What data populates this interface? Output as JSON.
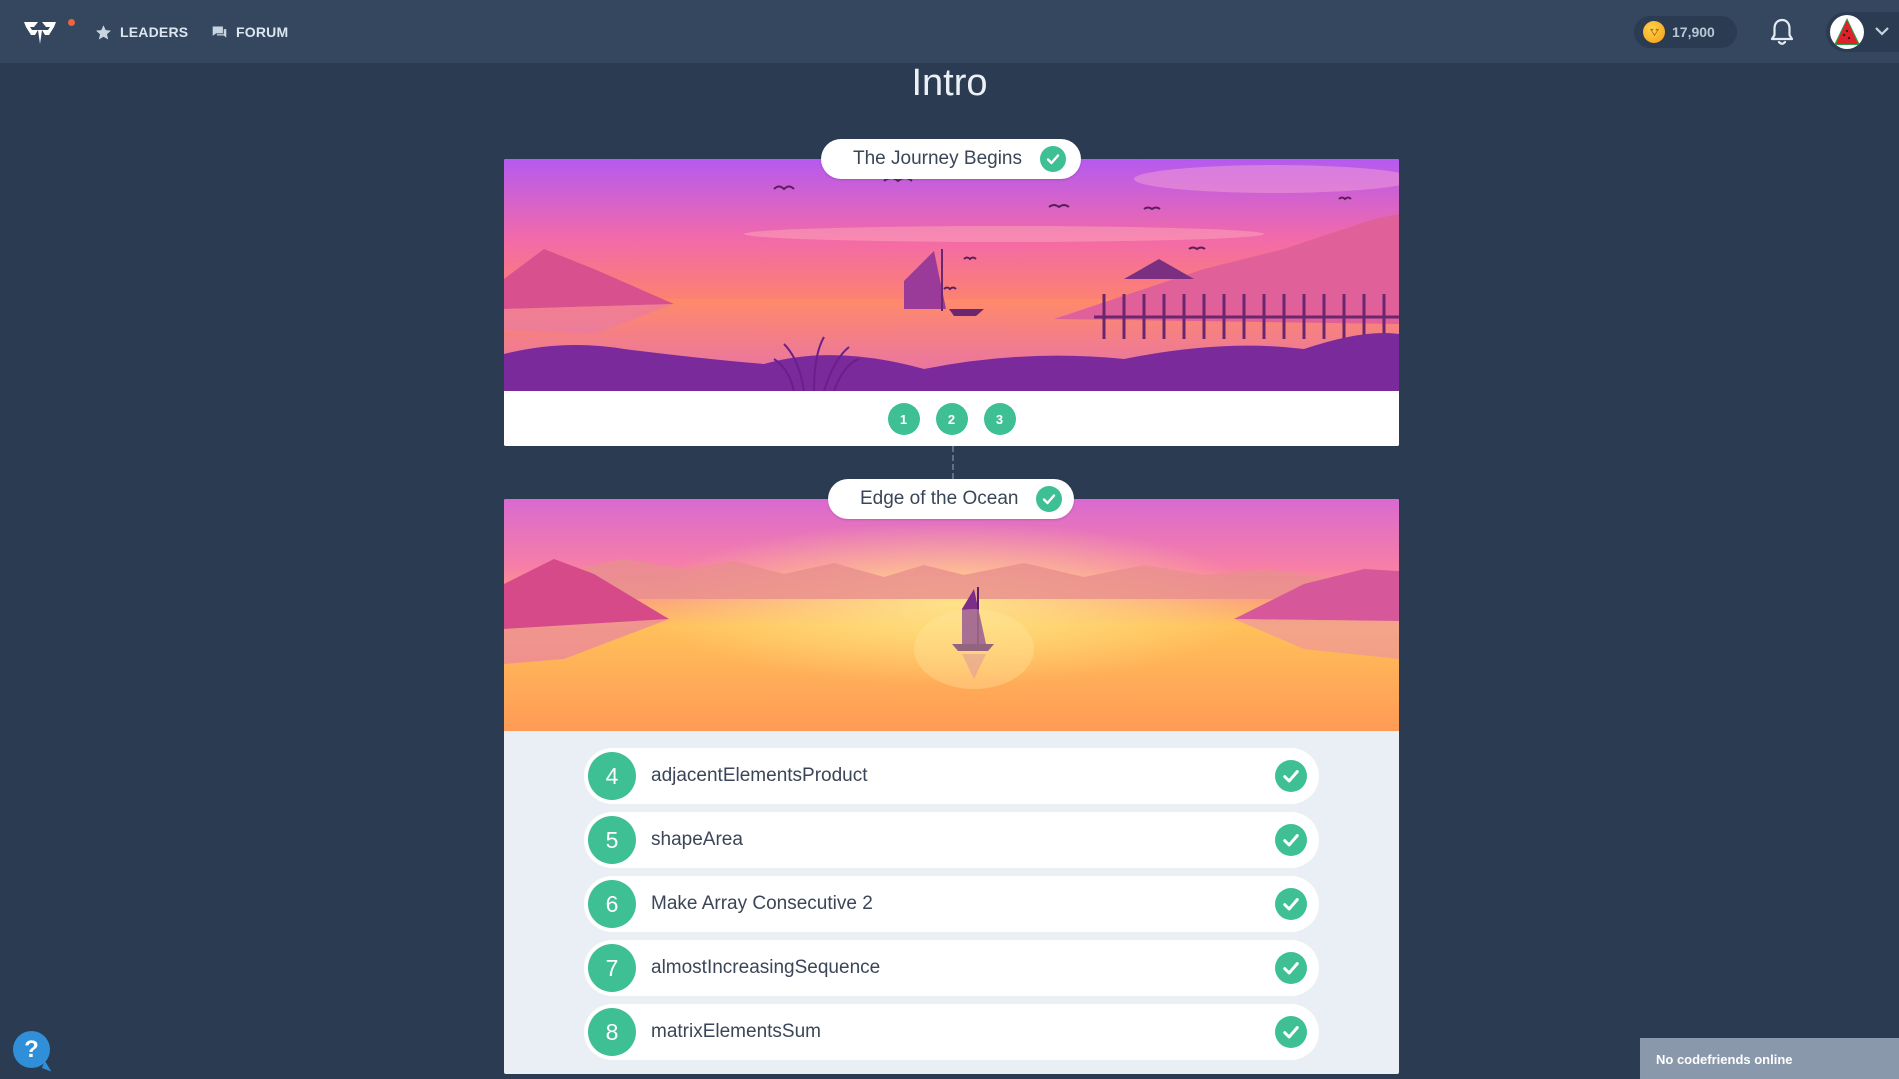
{
  "nav": {
    "leaders_label": "LEADERS",
    "forum_label": "FORUM",
    "coins": "17,900",
    "icons": [
      "codesignal-logo-icon",
      "star-icon",
      "forum-icon",
      "coin-icon",
      "bell-icon",
      "avatar",
      "chevron-down-icon"
    ]
  },
  "page": {
    "title": "Intro"
  },
  "levels": [
    {
      "title": "The Journey Begins",
      "completed": true,
      "steps": [
        "1",
        "2",
        "3"
      ]
    },
    {
      "title": "Edge of the Ocean",
      "completed": true,
      "tasks": [
        {
          "num": "4",
          "name": "adjacentElementsProduct",
          "completed": true
        },
        {
          "num": "5",
          "name": "shapeArea",
          "completed": true
        },
        {
          "num": "6",
          "name": "Make Array Consecutive 2",
          "completed": true
        },
        {
          "num": "7",
          "name": "almostIncreasingSequence",
          "completed": true
        },
        {
          "num": "8",
          "name": "matrixElementsSum",
          "completed": true
        }
      ]
    }
  ],
  "footer": {
    "help_label": "?",
    "codefriends_status": "No codefriends online"
  },
  "colors": {
    "topbar": "#34475f",
    "background": "#2b3b52",
    "accent_green": "#3fbf94"
  }
}
